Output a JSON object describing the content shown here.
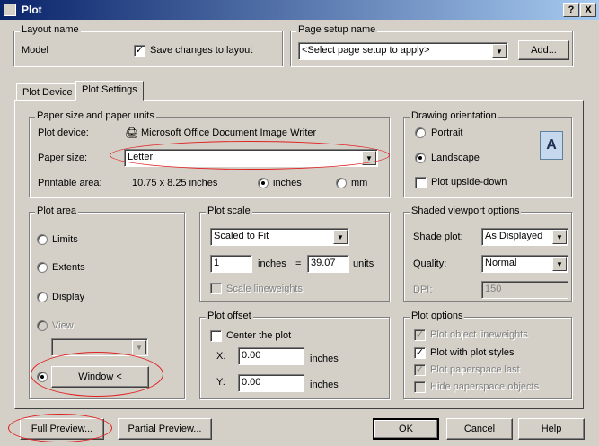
{
  "window": {
    "title": "Plot",
    "help_btn": "?",
    "close_btn": "X"
  },
  "layout_name": {
    "label": "Layout name",
    "value": "Model",
    "save_label": "Save changes to layout",
    "save_checked": true
  },
  "page_setup": {
    "label": "Page setup name",
    "value": "<Select page setup to apply>",
    "add_label": "Add..."
  },
  "tabs": [
    {
      "label": "Plot Device"
    },
    {
      "label": "Plot Settings"
    }
  ],
  "paper": {
    "group_label": "Paper size and paper units",
    "device_label": "Plot device:",
    "device_value": "Microsoft Office Document Image Writer",
    "size_label": "Paper size:",
    "size_value": "Letter",
    "printable_label": "Printable area:",
    "printable_value": "10.75 x 8.25 inches",
    "inches_label": "inches",
    "mm_label": "mm"
  },
  "orientation": {
    "group_label": "Drawing orientation",
    "portrait": "Portrait",
    "landscape": "Landscape",
    "upside": "Plot upside-down",
    "icon_letter": "A"
  },
  "plot_area": {
    "group_label": "Plot area",
    "limits": "Limits",
    "extents": "Extents",
    "display": "Display",
    "view": "View",
    "window_btn": "Window <"
  },
  "plot_scale": {
    "group_label": "Plot scale",
    "scale_value": "Scaled to Fit",
    "num1": "1",
    "unit1": "inches",
    "equals": "=",
    "num2": "39.07",
    "unit2": "units",
    "lineweights": "Scale lineweights"
  },
  "plot_offset": {
    "group_label": "Plot offset",
    "center": "Center the plot",
    "x_label": "X:",
    "x_value": "0.00",
    "x_unit": "inches",
    "y_label": "Y:",
    "y_value": "0.00",
    "y_unit": "inches"
  },
  "shaded": {
    "group_label": "Shaded viewport options",
    "shade_label": "Shade plot:",
    "shade_value": "As Displayed",
    "quality_label": "Quality:",
    "quality_value": "Normal",
    "dpi_label": "DPI:",
    "dpi_value": "150"
  },
  "plot_options": {
    "group_label": "Plot options",
    "lineweights": "Plot object lineweights",
    "styles": "Plot with plot styles",
    "paperspace_last": "Plot paperspace last",
    "hide": "Hide paperspace objects"
  },
  "footer": {
    "full_preview": "Full Preview...",
    "partial_preview": "Partial Preview...",
    "ok": "OK",
    "cancel": "Cancel",
    "help": "Help"
  },
  "colors": {
    "highlight_ellipse": "#e02020",
    "titlebar": "#0a246a"
  }
}
